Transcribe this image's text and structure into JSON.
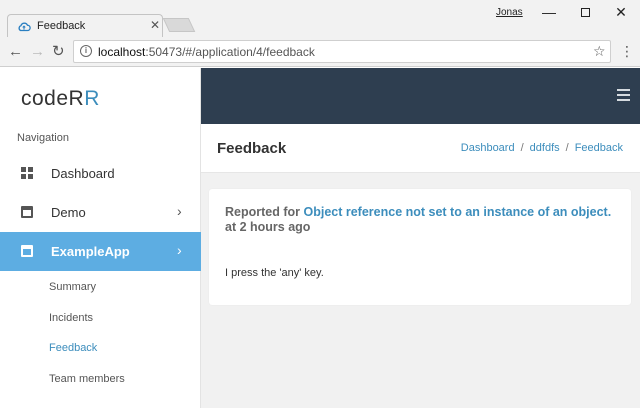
{
  "browser": {
    "tab_title": "Feedback",
    "profile_name": "Jonas",
    "url_host": "localhost",
    "url_rest": ":50473/#/application/4/feedback"
  },
  "app": {
    "logo_main": "codeR",
    "logo_accent": "R",
    "nav_heading": "Navigation",
    "nav_items": [
      {
        "label": "Dashboard",
        "icon": "dashboard-icon"
      },
      {
        "label": "Demo",
        "icon": "window-icon"
      },
      {
        "label": "ExampleApp",
        "icon": "window-icon",
        "active": true
      }
    ],
    "sub_items": [
      "Summary",
      "Incidents",
      "Feedback",
      "Team members"
    ],
    "current_sub": "Feedback",
    "accent_color": "#5dade2",
    "topbar_color": "#2e3e50"
  },
  "page": {
    "title": "Feedback",
    "breadcrumb": [
      "Dashboard",
      "ddfdfs",
      "Feedback"
    ],
    "breadcrumb_sep": "/",
    "feedback": {
      "reported_prefix": "Reported for",
      "incident_link": "Object reference not set to an instance of an object.",
      "time_ago": "at 2 hours ago",
      "message": "I press the 'any' key."
    }
  }
}
